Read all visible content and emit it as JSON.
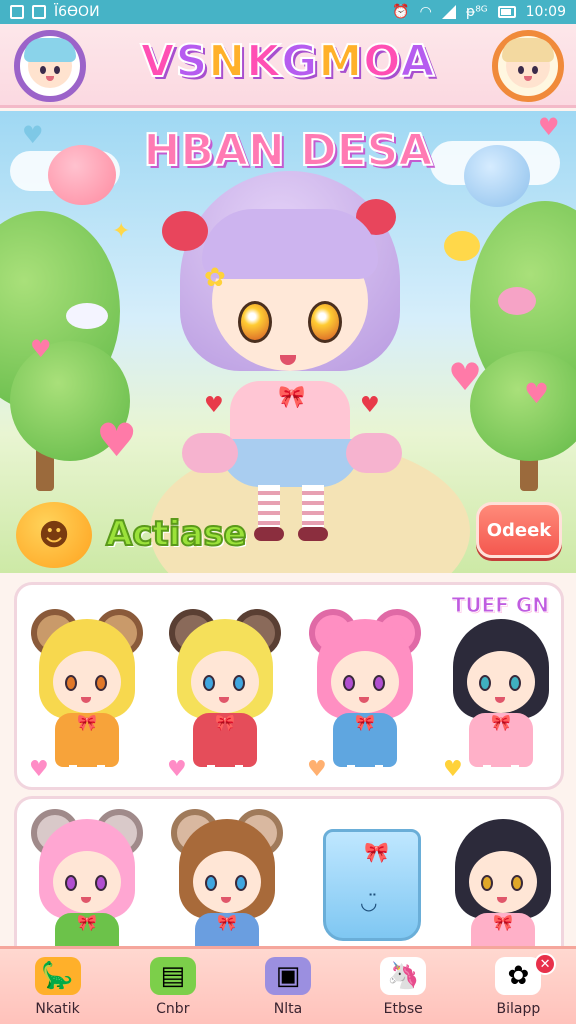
{
  "status_bar": {
    "carrier": "Ϊ6ϴΟИ",
    "signal_text": "ᵽ⁸ᴳ",
    "time": "10:09"
  },
  "header": {
    "app_title": "VSNKGMOA",
    "left_avatar_icon": "girl-avatar-icon",
    "right_avatar_icon": "girl-avatar-icon"
  },
  "scene": {
    "title": "HBAN DESA",
    "action_label": "Actiase",
    "action_emoji_icon": "smiley-icon",
    "check_button": "Odeek"
  },
  "grid": {
    "title": "TUEF GN",
    "row1": [
      {
        "hair": "#f7d84e",
        "eye": "#e0782a",
        "dress": "#f7a33a",
        "ear": "#c99a6a",
        "earin": "#8a5a3a",
        "fav_color": "#ff8cc6"
      },
      {
        "hair": "#f5e05a",
        "eye": "#3fa6e0",
        "dress": "#e54d5a",
        "ear": "#8a6a5a",
        "earin": "#5a3f33",
        "fav_color": "#ff8cc6"
      },
      {
        "hair": "#ff8fc2",
        "eye": "#b04fd0",
        "dress": "#5fa6e0",
        "ear": "#ff8fc2",
        "earin": "#e06aa6",
        "fav_color": "#ffb070"
      },
      {
        "hair": "#2c2a3a",
        "eye": "#3fb0c0",
        "dress": "#ffb0c8",
        "ear": "transparent",
        "earin": "transparent",
        "fav_color": "#ffd23a"
      }
    ],
    "row2": [
      {
        "hair": "#ffa6d2",
        "eye": "#b04fd0",
        "dress": "#6cc24a",
        "ear": "#d9c9c9",
        "earin": "#a08a8a"
      },
      {
        "hair": "#a86a3a",
        "eye": "#3fa6e0",
        "dress": "#6a9ee0",
        "ear": "#d9b8a0",
        "earin": "#a07a5a"
      },
      {
        "hair": "#2c2a3a",
        "eye": "#e0a82a",
        "dress": "#ffb0c8",
        "ear": "transparent",
        "earin": "transparent"
      }
    ]
  },
  "nav": [
    {
      "label": "Nkatik",
      "icon": "dino-icon",
      "color": "#ffb02a"
    },
    {
      "label": "Cnbr",
      "icon": "chat-icon",
      "color": "#7ccf4a"
    },
    {
      "label": "Nlta",
      "icon": "tv-icon",
      "color": "#9b8fe0"
    },
    {
      "label": "Etbse",
      "icon": "unicorn-icon",
      "color": "#ffffff"
    },
    {
      "label": "Bilapp",
      "icon": "flower-icon",
      "color": "#ffffff",
      "badge": "✕"
    }
  ]
}
